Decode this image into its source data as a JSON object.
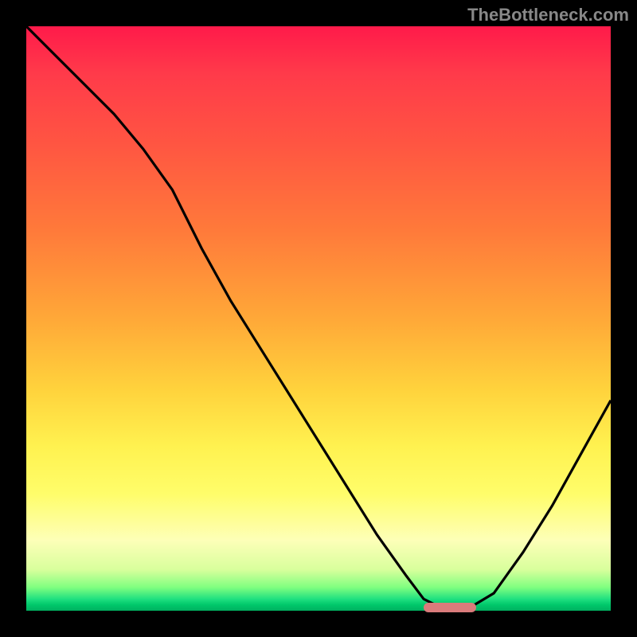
{
  "watermark": "TheBottleneck.com",
  "colors": {
    "background": "#000000",
    "line": "#000000",
    "marker": "#da7b7b",
    "gradient_top": "#ff1a4a",
    "gradient_bottom": "#00b060"
  },
  "chart_data": {
    "type": "line",
    "title": "",
    "xlabel": "",
    "ylabel": "",
    "xlim": [
      0,
      100
    ],
    "ylim": [
      0,
      100
    ],
    "gradient_meaning": "red=high bottleneck, green=low bottleneck",
    "series": [
      {
        "name": "bottleneck-curve",
        "x": [
          0,
          5,
          10,
          15,
          20,
          25,
          30,
          35,
          40,
          45,
          50,
          55,
          60,
          65,
          68,
          72,
          75,
          80,
          85,
          90,
          95,
          100
        ],
        "values": [
          100,
          95,
          90,
          85,
          79,
          72,
          62,
          53,
          45,
          37,
          29,
          21,
          13,
          6,
          2,
          0,
          0,
          3,
          10,
          18,
          27,
          36
        ]
      }
    ],
    "marker": {
      "name": "optimal-point",
      "x_start": 68,
      "x_end": 77,
      "y": 0
    },
    "annotations": []
  }
}
